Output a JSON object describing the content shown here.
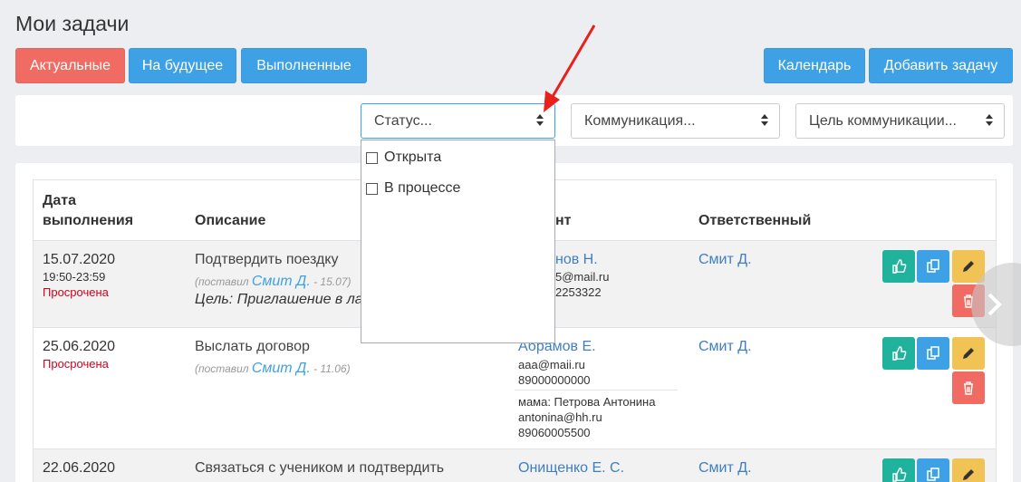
{
  "page": {
    "title": "Мои задачи"
  },
  "tabs": {
    "current": "Актуальные",
    "future": "На будущее",
    "done": "Выполненные"
  },
  "actions": {
    "calendar": "Календарь",
    "add_task": "Добавить задачу"
  },
  "filters": {
    "status": "Статус...",
    "communication": "Коммуникация...",
    "goal": "Цель коммуникации...",
    "status_options": [
      "Открыта",
      "В процессе"
    ]
  },
  "table": {
    "headers": {
      "date_line1": "Дата",
      "date_line2": "выполнения",
      "description": "Описание",
      "client": "нт",
      "responsible": "Ответственный"
    },
    "rows": [
      {
        "date": "15.07.2020",
        "time": "19:50-23:59",
        "status": "Просрочена",
        "description": "Подтвердить поездку",
        "meta_pre": "(поставил ",
        "meta_author": "Смит Д.",
        "meta_post": " - 15.07)",
        "goal": "Цель: Приглашение в лаг",
        "client_name": "нов Н.",
        "client_email": "5@mail.ru",
        "client_phone": "2253322",
        "responsible": "Смит Д."
      },
      {
        "date": "25.06.2020",
        "status": "Просрочена",
        "description": "Выслать договор",
        "meta_pre": "(поставил ",
        "meta_author": "Смит Д.",
        "meta_post": " - 11.06)",
        "client_name": "Абрамов Е.",
        "client_email": "aaa@maii.ru",
        "client_phone": "89000000000",
        "relative_name": "мама: Петрова Антонина",
        "relative_email": "antonina@hh.ru",
        "relative_phone": "89060005500",
        "responsible": "Смит Д."
      },
      {
        "date": "22.06.2020",
        "description": "Связаться с учеником и подтвердить",
        "client_name": "Онищенко Е. С.",
        "responsible": "Смит Д."
      }
    ]
  },
  "colors": {
    "red": "#f06b62",
    "blue": "#3ea1e6",
    "green": "#20b29c",
    "yellow": "#f1c254",
    "overdue": "#d0021b",
    "annotation_arrow": "#e8211a"
  },
  "icons": {
    "like": "thumbs-up-icon",
    "copy": "copy-icon",
    "edit": "pencil-icon",
    "delete": "trash-icon",
    "next": "chevron-right-icon"
  }
}
